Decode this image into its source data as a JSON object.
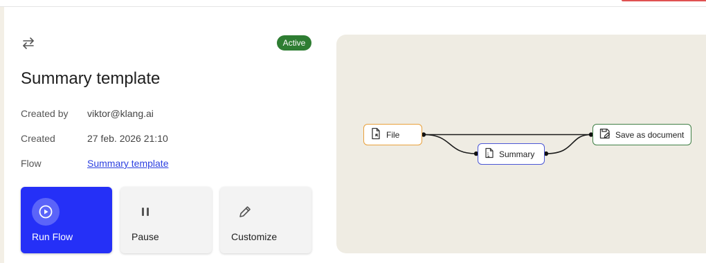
{
  "header": {
    "accent_color": "#e05252"
  },
  "flow": {
    "icon": "repeat-icon",
    "status": "Active",
    "status_color": "#2e7d32",
    "title": "Summary template",
    "meta": [
      {
        "label": "Created by",
        "value": "viktor@klang.ai"
      },
      {
        "label": "Created",
        "value": "27 feb. 2026 21:10"
      },
      {
        "label": "Flow",
        "value": "Summary template"
      }
    ]
  },
  "actions": [
    {
      "label": "Run Flow",
      "icon": "play-circle-icon",
      "color": "#2530f7"
    },
    {
      "label": "Pause",
      "icon": "pause-icon"
    },
    {
      "label": "Customize",
      "icon": "pencil-icon"
    }
  ],
  "diagram": {
    "background": "#efece3",
    "nodes": [
      {
        "id": "file",
        "label": "File",
        "icon": "file-import-icon",
        "border_color": "#e8a03b"
      },
      {
        "id": "summary",
        "label": "Summary",
        "icon": "document-text-icon",
        "border_color": "#4a56d6"
      },
      {
        "id": "save",
        "label": "Save as document",
        "icon": "save-doc-icon",
        "border_color": "#3f7f45"
      }
    ],
    "edges": [
      {
        "from": "file",
        "to": "save"
      },
      {
        "from": "file",
        "to": "summary"
      },
      {
        "from": "summary",
        "to": "save"
      }
    ]
  }
}
